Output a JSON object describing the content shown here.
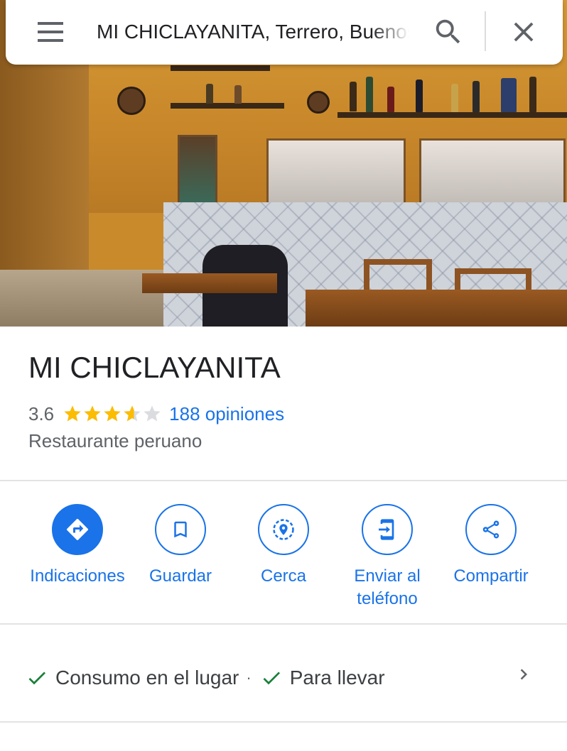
{
  "search": {
    "query": "MI CHICLAYANITA, Terrero, Buenos Aires"
  },
  "place": {
    "name": "MI CHICLAYANITA",
    "rating_value": "3.6",
    "rating_fraction": 0.72,
    "reviews_label": "188 opiniones",
    "category": "Restaurante peruano"
  },
  "actions": [
    {
      "label": "Indicaciones",
      "icon": "directions-icon"
    },
    {
      "label": "Guardar",
      "icon": "bookmark-icon"
    },
    {
      "label": "Cerca",
      "icon": "nearby-icon"
    },
    {
      "label": "Enviar al teléfono",
      "label_line1": "Enviar al",
      "label_line2": "teléfono",
      "icon": "send-to-phone-icon"
    },
    {
      "label": "Compartir",
      "icon": "share-icon"
    }
  ],
  "services": {
    "item1": "Consumo en el lugar",
    "separator": "·",
    "item2": "Para llevar"
  },
  "colors": {
    "accent": "#1a73e8",
    "star": "#fbbc04",
    "check": "#188038",
    "text_secondary": "#5f6368"
  }
}
